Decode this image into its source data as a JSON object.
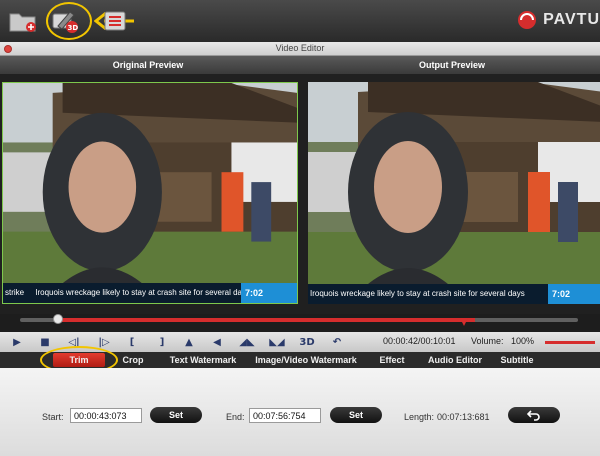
{
  "window": {
    "title": "Video Editor"
  },
  "brand": {
    "name": "PAVTU"
  },
  "toolbar": {
    "icons": [
      "folder-add-icon",
      "edit-3d-icon",
      "list-icon"
    ]
  },
  "preview": {
    "original_label": "Original Preview",
    "output_label": "Output Preview",
    "ticker_prefix": "strike",
    "ticker_text": "Iroquois wreckage likely to stay at crash site for several days",
    "ticker_time": "7:02"
  },
  "timeline": {
    "selection_start": 0.068,
    "selection_end": 0.815
  },
  "controls": {
    "icons": [
      "play-icon",
      "stop-icon",
      "previous-frame-icon",
      "next-frame-icon",
      "mark-in-icon",
      "mark-out-icon",
      "flip-vertical-icon",
      "snapshot-icon",
      "rotate-left-icon",
      "rotate-right-icon",
      "3d-icon",
      "undo-icon"
    ],
    "three_d_label": "3D",
    "time": "00:00:42/00:10:01",
    "volume_label": "Volume:",
    "volume_value": "100%",
    "volume_level": 1.0
  },
  "tabs": [
    {
      "label": "Trim",
      "active": true
    },
    {
      "label": "Crop"
    },
    {
      "label": "Text Watermark"
    },
    {
      "label": "Image/Video Watermark"
    },
    {
      "label": "Effect"
    },
    {
      "label": "Audio Editor"
    },
    {
      "label": "Subtitle"
    }
  ],
  "trim": {
    "start_label": "Start:",
    "start_value": "00:00:43:073",
    "set_label": "Set",
    "end_label": "End:",
    "end_value": "00:07:56:754",
    "length_label": "Length:",
    "length_value": "00:07:13:681"
  },
  "colors": {
    "accent": "#d62d2d",
    "highlight": "#f2c500",
    "tab_active": "#c8261c",
    "ticker_time_bg": "#1e8fd6"
  }
}
